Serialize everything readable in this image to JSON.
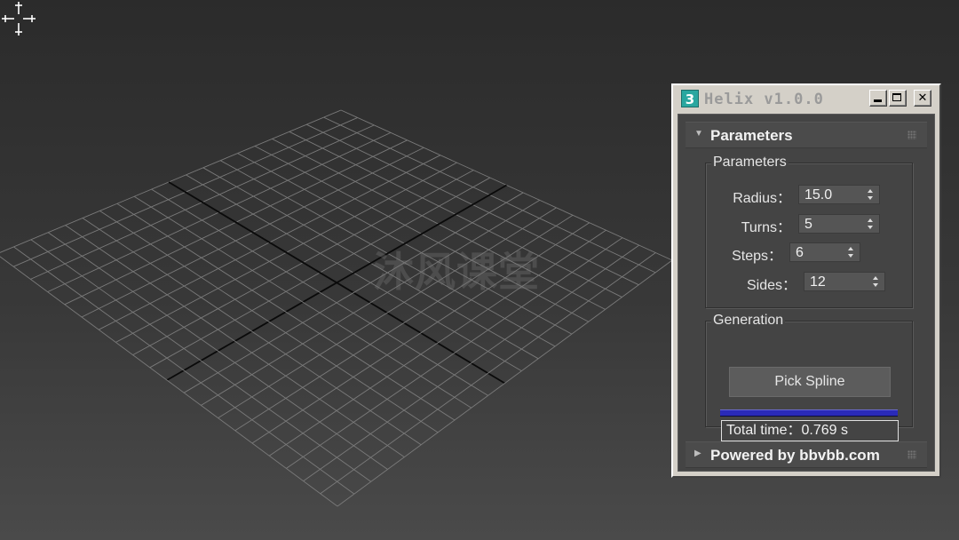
{
  "window": {
    "title": "Helix v1.0.0",
    "app_icon_label": "3",
    "min_icon": "minimize-icon",
    "max_icon": "maximize-icon",
    "close_icon": "close-icon",
    "close_glyph": "✕"
  },
  "rollouts": [
    {
      "label": "Parameters",
      "arrow": "▼",
      "expanded": true
    },
    {
      "label": "Powered by bbvbb.com",
      "arrow": "▶",
      "expanded": false
    }
  ],
  "parameters_group": {
    "title": "Parameters",
    "fields": [
      {
        "label": "Radius：",
        "value": "15.0"
      },
      {
        "label": "Turns：",
        "value": "5"
      },
      {
        "label": "Steps：",
        "value": "6"
      },
      {
        "label": "Sides：",
        "value": "12"
      }
    ]
  },
  "generation_group": {
    "title": "Generation",
    "pick_button_label": "Pick Spline",
    "progress": 1.0,
    "total_time_text": "Total time：0.769 s"
  },
  "viewport": {
    "watermark_text": "沐风课堂",
    "cursor_icon": "move-crosshair-icon"
  },
  "colors": {
    "progress_bar": "#2a2ab8",
    "app_icon": "#2aa7a0"
  }
}
